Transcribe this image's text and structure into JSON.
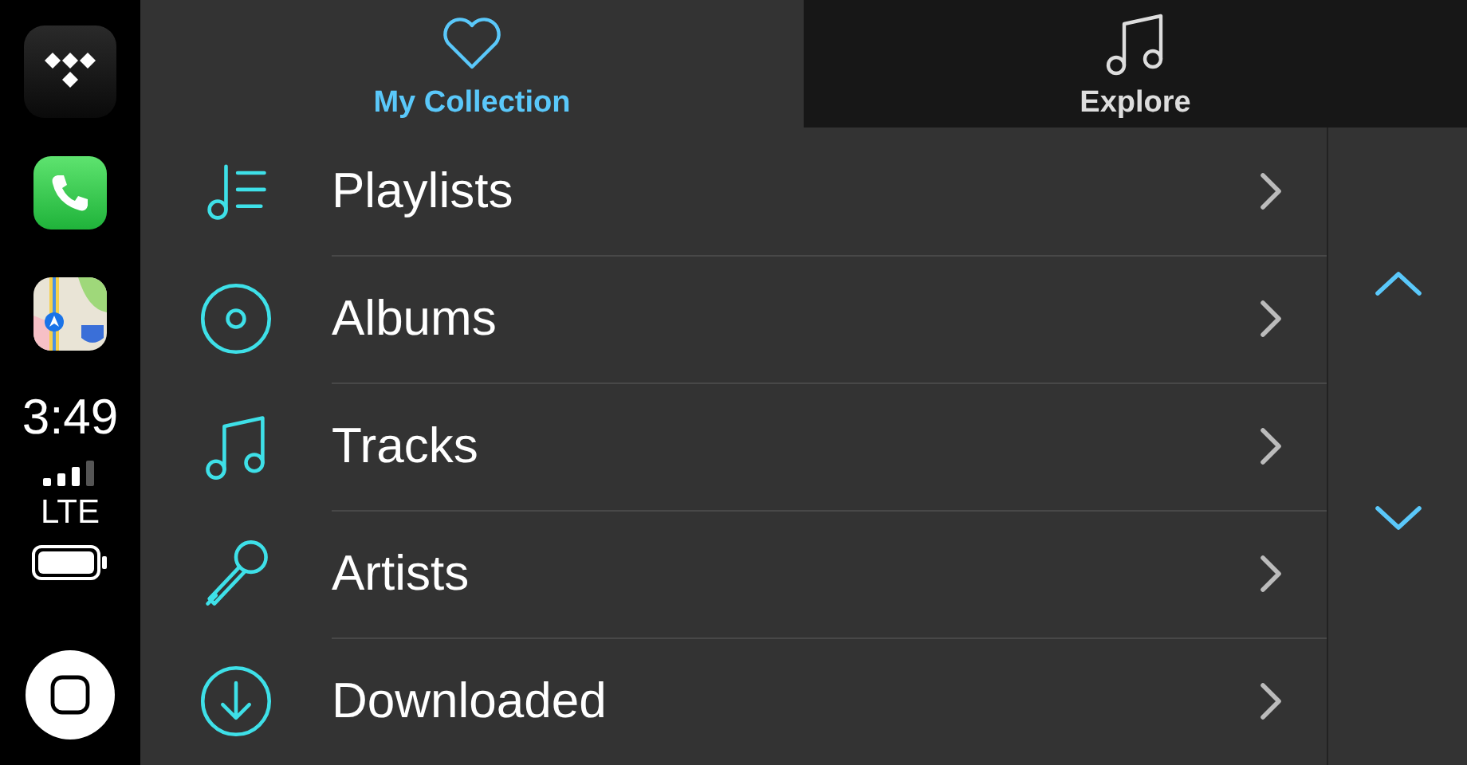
{
  "status": {
    "time": "3:49",
    "network": "LTE"
  },
  "tabs": [
    {
      "label": "My Collection",
      "kind": "heart",
      "selected": true
    },
    {
      "label": "Explore",
      "kind": "note",
      "selected": false
    }
  ],
  "items": [
    {
      "label": "Playlists",
      "kind": "playlist"
    },
    {
      "label": "Albums",
      "kind": "disc"
    },
    {
      "label": "Tracks",
      "kind": "note"
    },
    {
      "label": "Artists",
      "kind": "mic"
    },
    {
      "label": "Downloaded",
      "kind": "download"
    }
  ]
}
